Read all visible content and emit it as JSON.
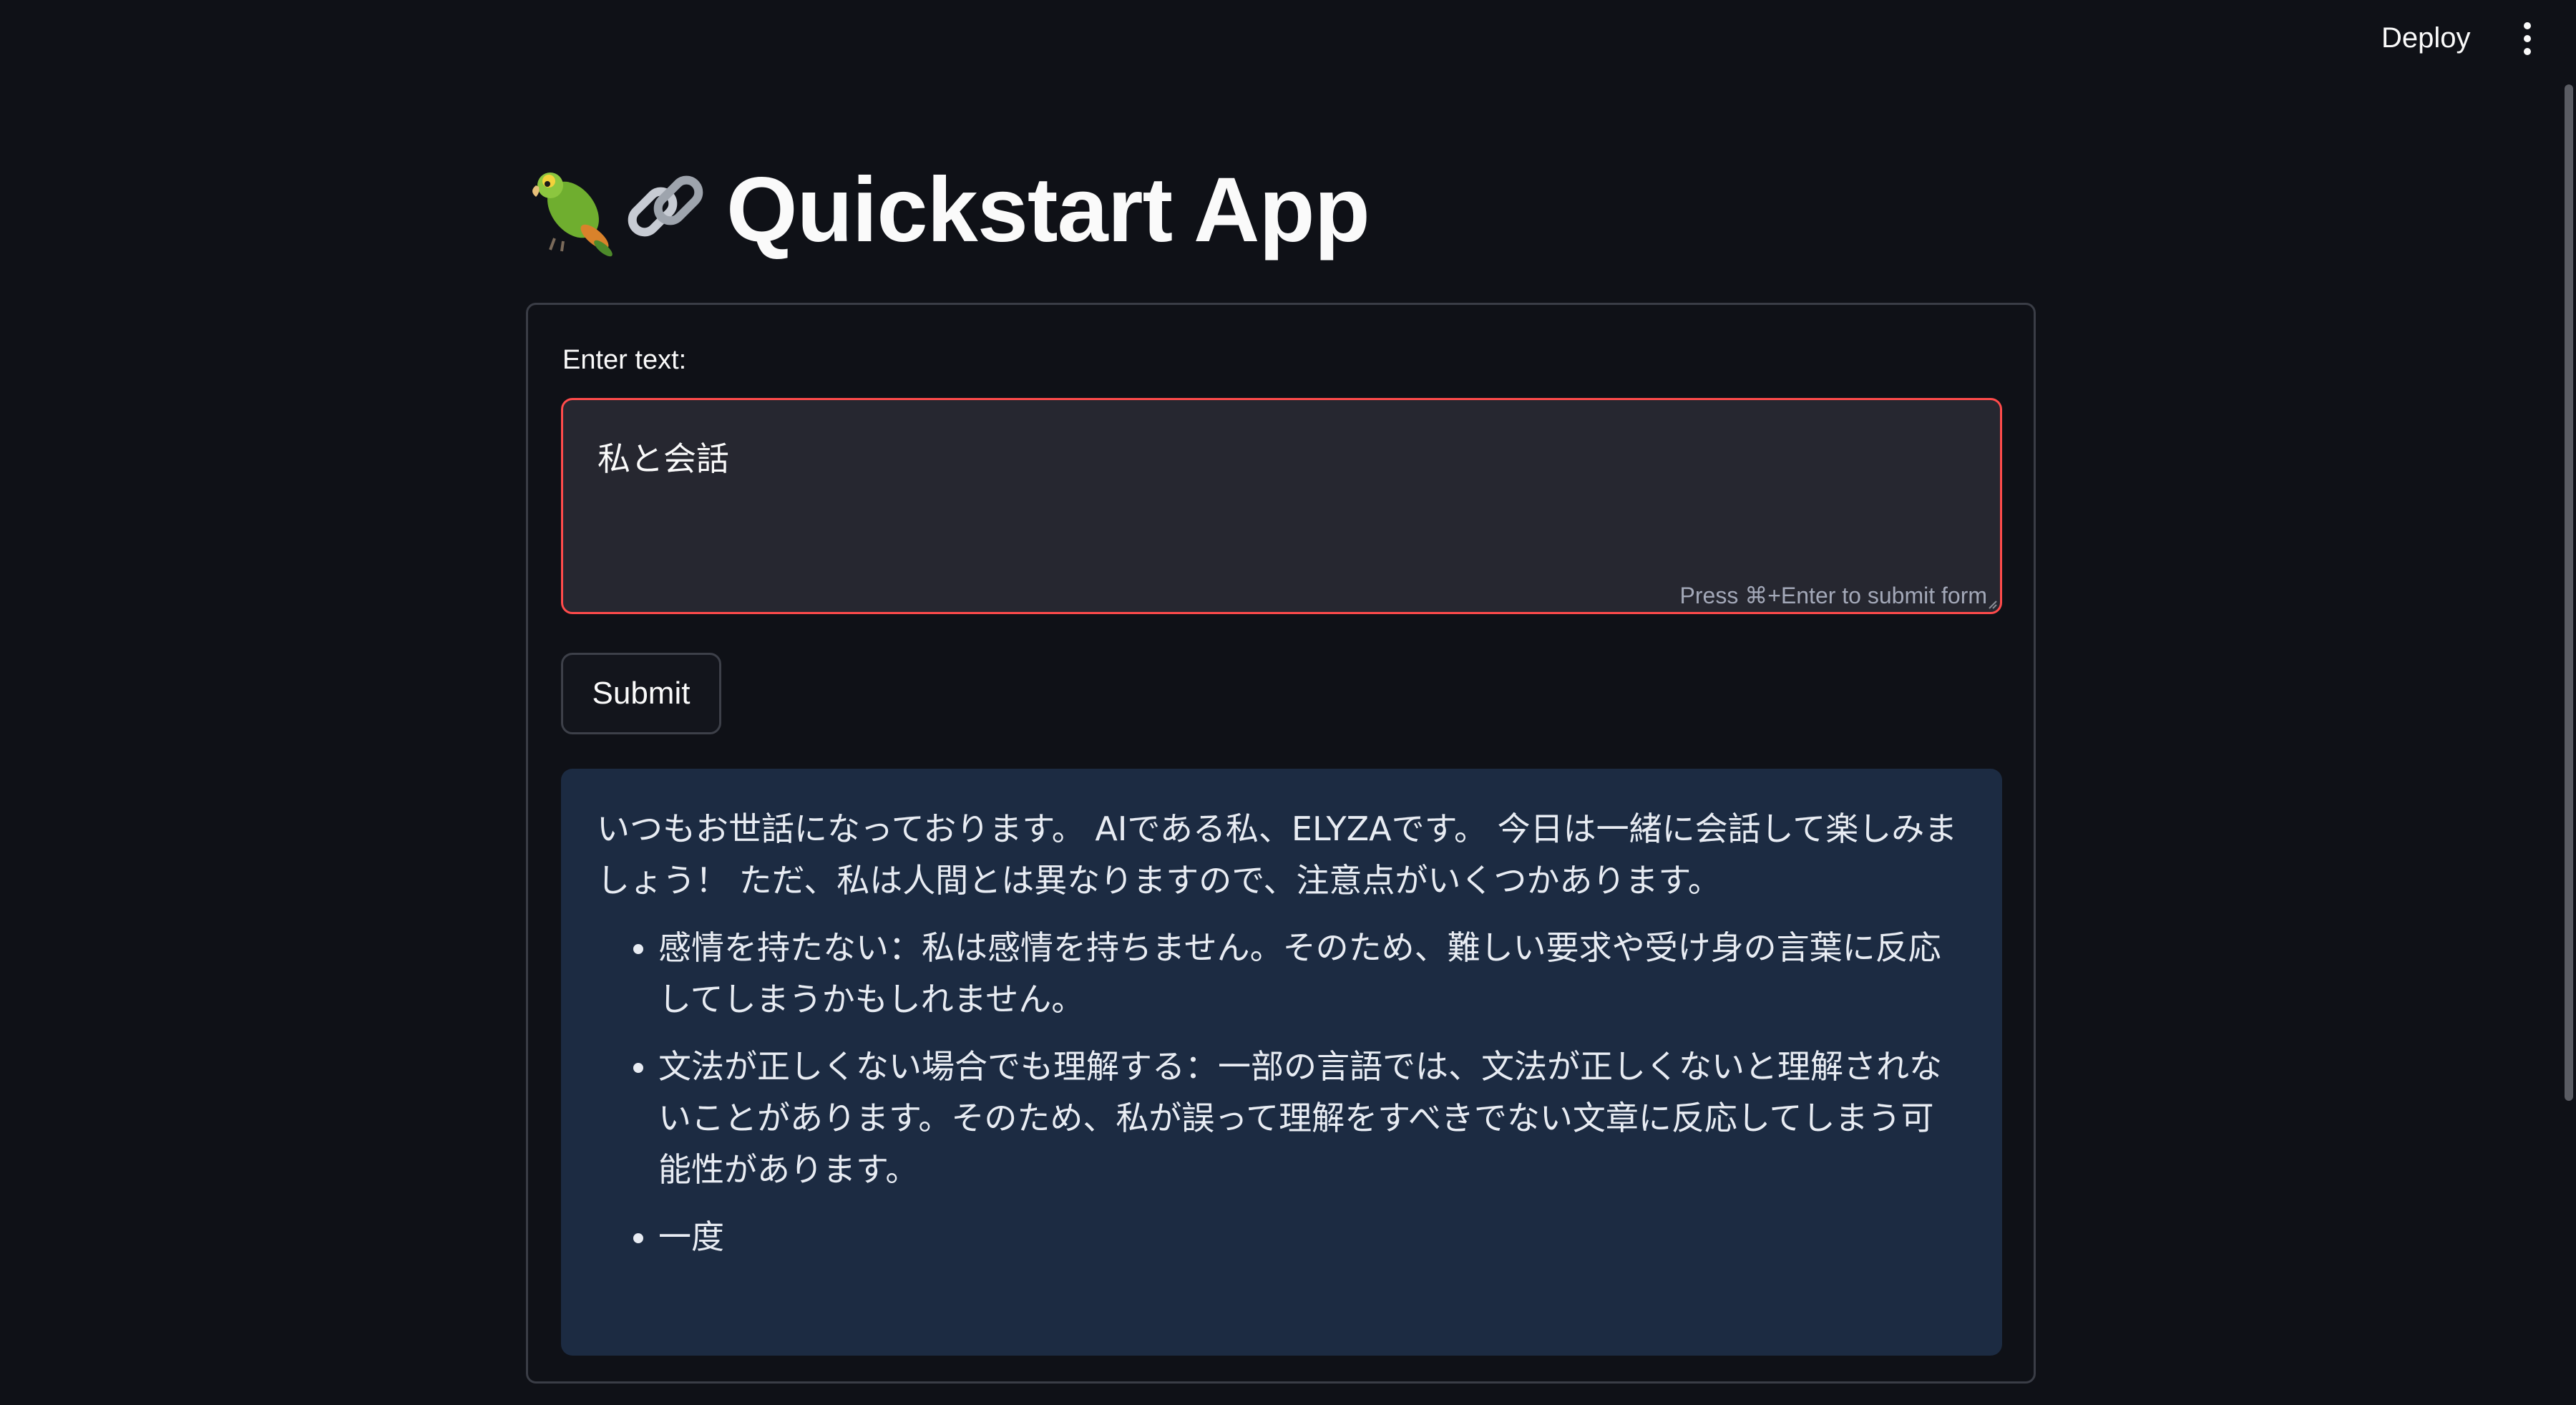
{
  "header": {
    "deploy_label": "Deploy"
  },
  "page": {
    "icons": [
      "parrot-icon",
      "link-icon"
    ],
    "title": "Quickstart App"
  },
  "form": {
    "label": "Enter text:",
    "input_value": "私と会話",
    "hint": "Press ⌘+Enter to submit form",
    "submit_label": "Submit",
    "accent_color": "#ff4b4b"
  },
  "result": {
    "intro": "いつもお世話になっております。 AIである私、ELYZAです。 今日は一緒に会話して楽しみましょう！ ただ、私は人間とは異なりますので、注意点がいくつかあります。",
    "items": [
      "感情を持たない：私は感情を持ちません。そのため、難しい要求や受け身の言葉に反応してしまうかもしれません。",
      "文法が正しくない場合でも理解する：一部の言語では、文法が正しくないと理解されないことがあります。そのため、私が誤って理解をすべきでない文章に反応してしまう可能性があります。",
      "一度"
    ],
    "background_color": "#1c2b42"
  }
}
